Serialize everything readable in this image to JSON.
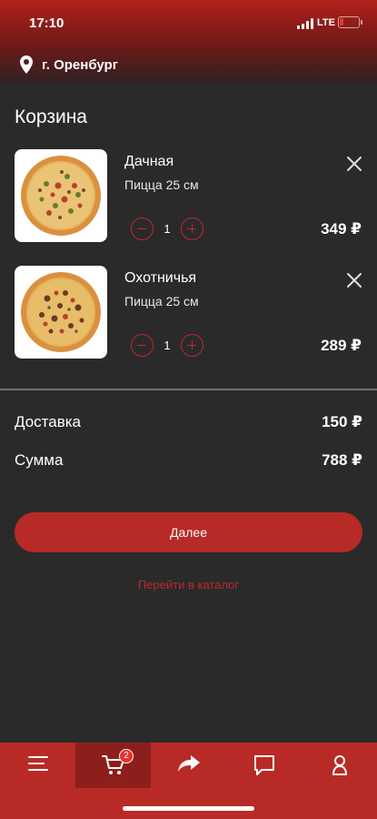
{
  "status_bar": {
    "time": "17:10",
    "network": "LTE",
    "battery_level": 0.2,
    "battery_color": "#e03a30"
  },
  "location": {
    "icon": "location-pin-icon",
    "city": "г. Оренбург"
  },
  "page": {
    "title": "Корзина"
  },
  "cart": {
    "items": [
      {
        "name": "Дачная",
        "description": "Пицца 25 см",
        "quantity": "1",
        "price": "349 ₽"
      },
      {
        "name": "Охотничья",
        "description": "Пицца 25 см",
        "quantity": "1",
        "price": "289 ₽"
      }
    ]
  },
  "summary": {
    "delivery_label": "Доставка",
    "delivery_value": "150 ₽",
    "total_label": "Сумма",
    "total_value": "788 ₽"
  },
  "actions": {
    "next_label": "Далее",
    "catalog_link": "Перейти в каталог"
  },
  "tabbar": {
    "items": [
      {
        "icon": "menu-icon"
      },
      {
        "icon": "cart-icon",
        "badge": "2",
        "active": true
      },
      {
        "icon": "share-arrow-icon"
      },
      {
        "icon": "chat-icon"
      },
      {
        "icon": "profile-icon"
      }
    ]
  },
  "colors": {
    "accent": "#b82a26",
    "accent_dark": "#8c1f1c",
    "background": "#2a2a2a"
  }
}
